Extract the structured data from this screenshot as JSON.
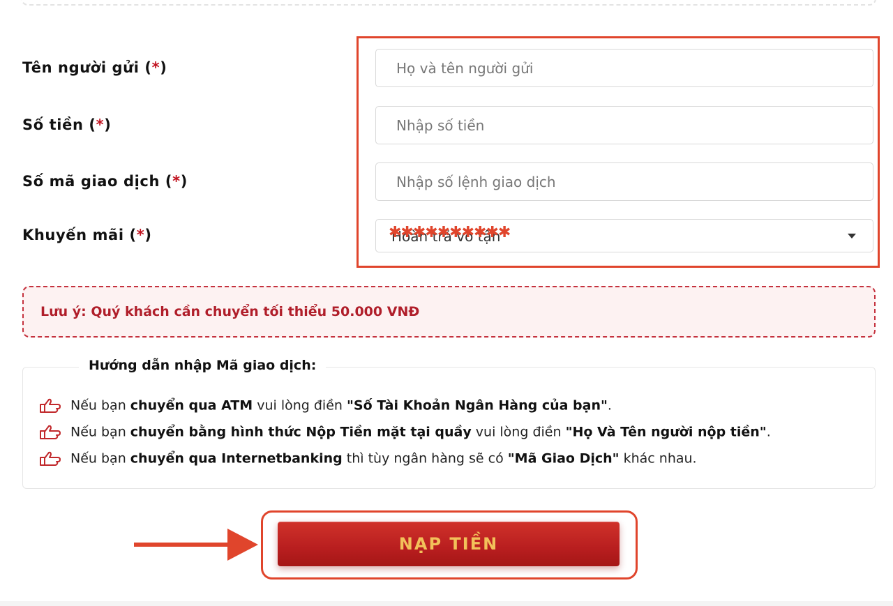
{
  "form": {
    "sender_name": {
      "label": "Tên người gửi",
      "required": "*",
      "placeholder": "Họ và tên người gửi"
    },
    "amount": {
      "label": "Số tiền",
      "required": "*",
      "placeholder": "Nhập số tiền"
    },
    "transaction_code": {
      "label": "Số mã giao dịch",
      "required": "*",
      "placeholder": "Nhập số lệnh giao dịch"
    },
    "promotion": {
      "label": "Khuyến mãi",
      "required": "*",
      "selected": "Hoàn trả vô tận"
    }
  },
  "notice": {
    "text": "Lưu ý: Quý khách cần chuyển tối thiểu 50.000 VNĐ"
  },
  "guide": {
    "title": "Hướng dẫn nhập Mã giao dịch:",
    "items": [
      {
        "prefix": "Nếu bạn ",
        "bold1": "chuyển qua ATM",
        "middle": " vui lòng điền ",
        "bold2": "\"Số Tài Khoản Ngân Hàng của bạn\"",
        "suffix": "."
      },
      {
        "prefix": "Nếu bạn ",
        "bold1": "chuyển bằng hình thức Nộp Tiền mặt tại quầy",
        "middle": " vui lòng điền ",
        "bold2": "\"Họ Và Tên người nộp tiền\"",
        "suffix": "."
      },
      {
        "prefix": "Nếu bạn ",
        "bold1": "chuyển qua Internetbanking",
        "middle": " thì tùy ngân hàng sẽ có ",
        "bold2": "\"Mã Giao Dịch\"",
        "suffix": " khác nhau."
      }
    ]
  },
  "submit": {
    "label": "NẠP TIỀN"
  },
  "colors": {
    "accent": "#e0452c",
    "required": "#c1121f",
    "button": "#b81e1f",
    "button_text": "#f2c15a"
  }
}
